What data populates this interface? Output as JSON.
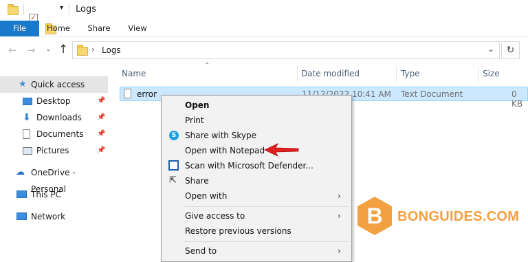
{
  "window": {
    "title": "Logs"
  },
  "ribbon": {
    "tabs": [
      "File",
      "Home",
      "Share",
      "View"
    ]
  },
  "address": {
    "path": "Logs"
  },
  "nav": {
    "items": [
      {
        "label": "Quick access",
        "pinned": false,
        "selected": true
      },
      {
        "label": "Desktop",
        "pinned": true
      },
      {
        "label": "Downloads",
        "pinned": true
      },
      {
        "label": "Documents",
        "pinned": true
      },
      {
        "label": "Pictures",
        "pinned": true
      },
      {
        "label": "OneDrive - Personal"
      },
      {
        "label": "This PC"
      },
      {
        "label": "Network"
      }
    ]
  },
  "columns": {
    "name": "Name",
    "date": "Date modified",
    "type": "Type",
    "size": "Size"
  },
  "files": [
    {
      "name": "error",
      "date": "11/12/2022 10:41 AM",
      "type": "Text Document",
      "size": "0 KB"
    }
  ],
  "context_menu": {
    "items": {
      "open": "Open",
      "print": "Print",
      "share_skype": "Share with Skype",
      "open_notepad": "Open with Notepad",
      "scan_defender": "Scan with Microsoft Defender...",
      "share": "Share",
      "open_with": "Open with",
      "give_access": "Give access to",
      "restore": "Restore previous versions",
      "send_to": "Send to"
    }
  },
  "watermark": {
    "text": "BONGUIDES.COM"
  },
  "colors": {
    "accent": "#1979ca",
    "selection": "#cce8ff",
    "arrow": "#e02020",
    "watermark": "#f3a040"
  }
}
